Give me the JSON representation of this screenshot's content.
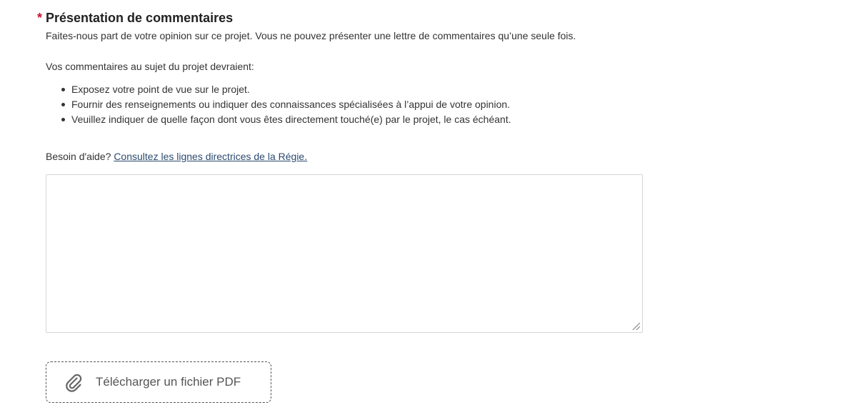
{
  "section": {
    "required_marker": "*",
    "title": "Présentation de commentaires",
    "intro": "Faites-nous part de votre opinion sur ce projet. Vous ne pouvez présenter une lettre de commentaires qu’une seule fois.",
    "lead": "Vos commentaires au sujet du projet devraient:",
    "bullets": [
      "Exposez votre point de vue sur le projet.",
      "Fournir des renseignements ou indiquer des connaissances spécialisées à l’appui de votre opinion.",
      "Veuillez indiquer de quelle façon dont vous êtes directement touché(e) par le projet, le cas échéant."
    ],
    "help_prefix": "Besoin d'aide?",
    "help_link": "Consultez les lignes directrices de la Régie."
  },
  "comment_field": {
    "value": "",
    "placeholder": ""
  },
  "upload": {
    "label": "Télécharger un fichier PDF",
    "icon": "paperclip-icon"
  },
  "colors": {
    "required": "#c8102e",
    "link": "#2b4a6f",
    "text": "#333333",
    "border": "#d6d6d6"
  }
}
